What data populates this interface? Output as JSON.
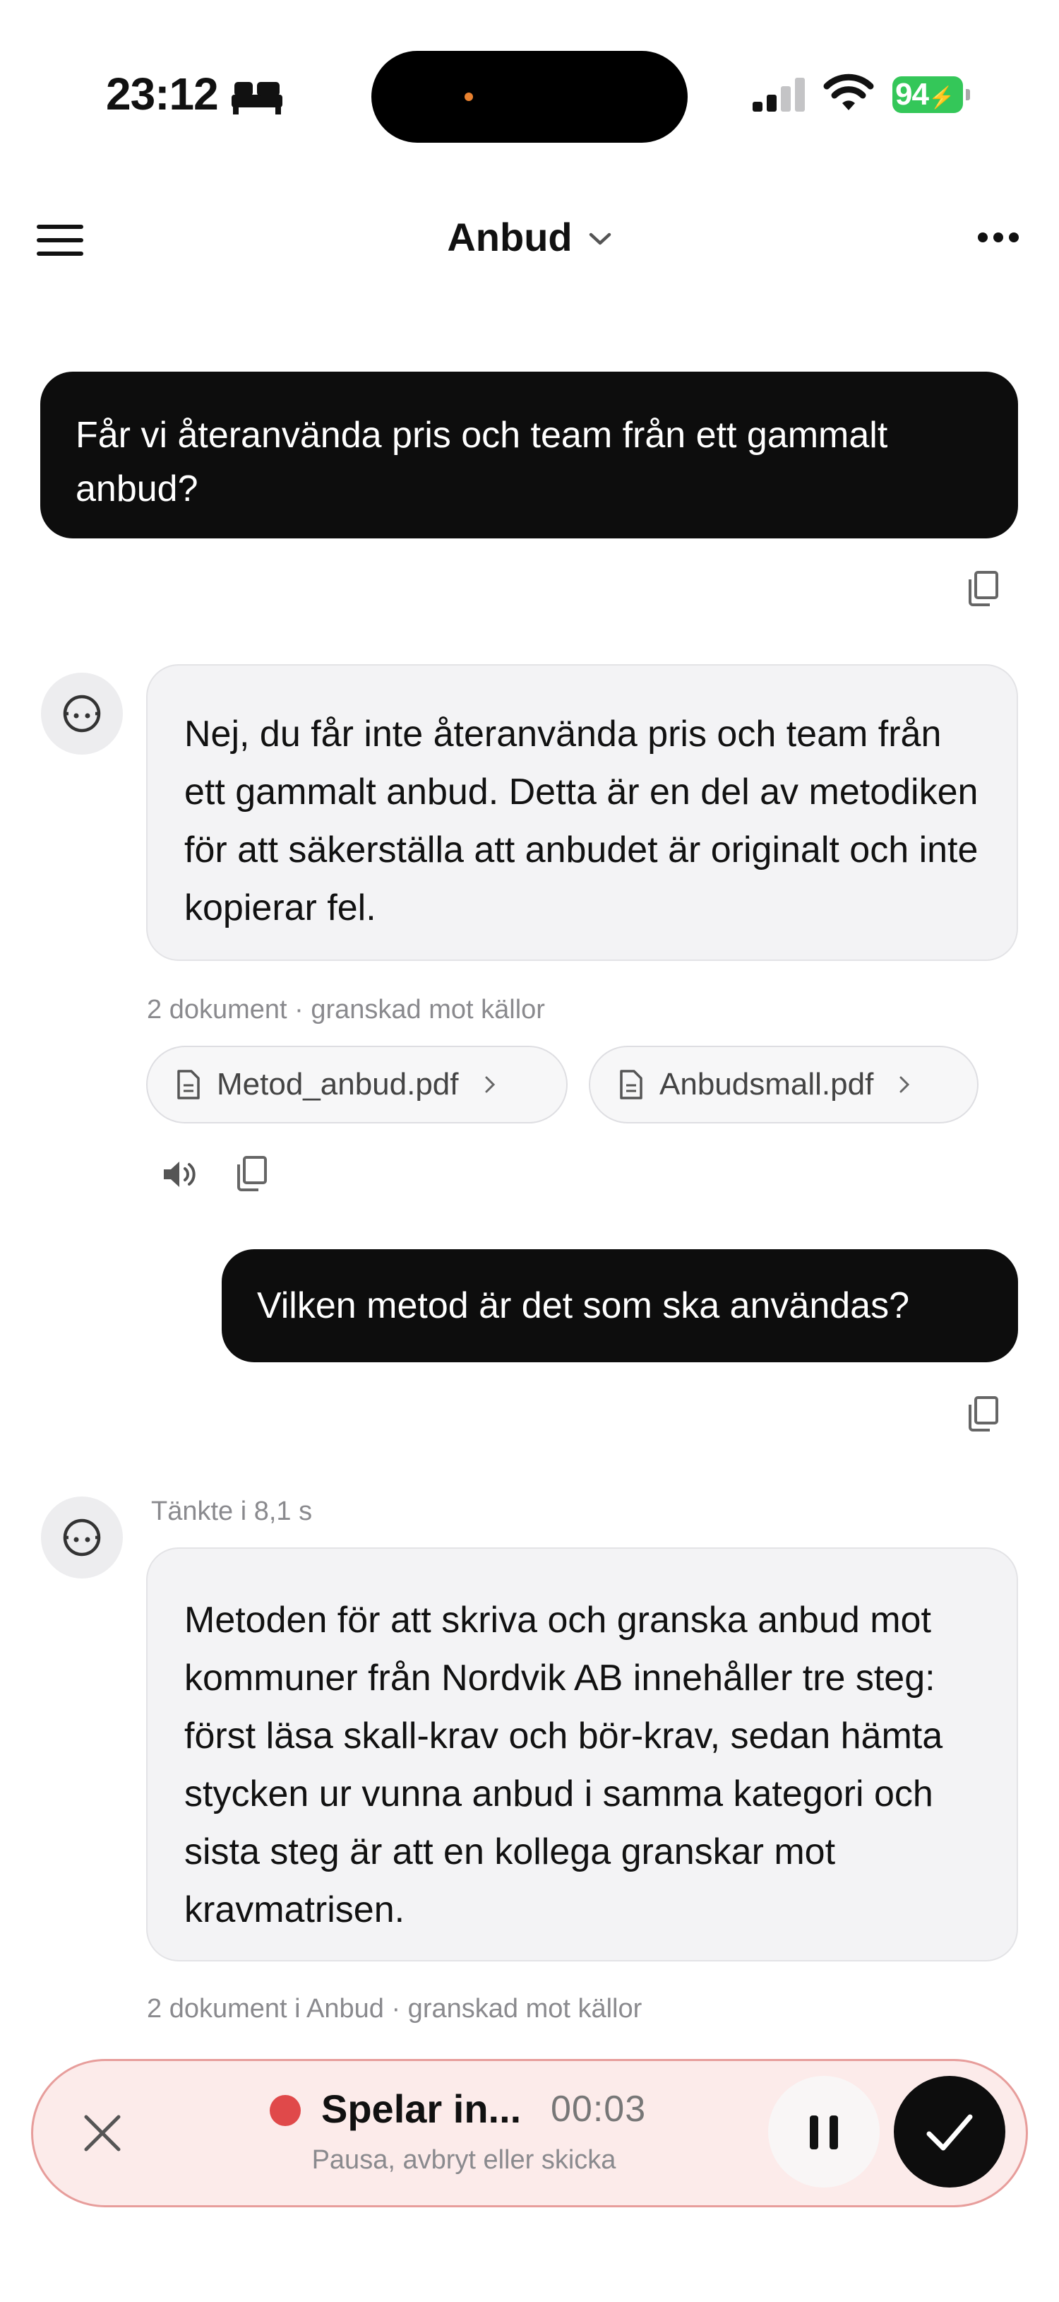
{
  "status_bar": {
    "time": "23:12",
    "battery": "94"
  },
  "header": {
    "title": "Anbud"
  },
  "conversation": {
    "user_message_1": "Får vi återanvända pris och team från ett gammalt anbud?",
    "assistant_message_1": "Nej, du får inte återanvända pris och team från ett gammalt anbud. Detta är en del av metodiken för att säkerställa att anbudet är originalt och inte kopierar fel.",
    "sources_1_meta": "2 dokument · granskad mot källor",
    "sources_1": [
      "Metod_anbud.pdf",
      "Anbudsmall.pdf"
    ],
    "user_message_2": "Vilken metod är det som ska användas?",
    "thinking_label": "Tänkte i 8,1 s",
    "assistant_message_2": "Metoden för att skriva och granska anbud mot kommuner från Nordvik AB innehåller tre steg: först läsa skall-krav och bör-krav, sedan hämta stycken ur vunna anbud i samma kategori och sista steg är att en kollega granskar mot kravmatrisen.",
    "sources_2_meta": "2 dokument i Anbud · granskad mot källor"
  },
  "recording": {
    "status": "Spelar in...",
    "timer": "00:03",
    "hint": "Pausa, avbryt eller skicka"
  },
  "colors": {
    "user_bubble": "#0d0d0d",
    "assistant_bubble": "#f3f3f5",
    "recording_bg": "#fcebea",
    "recording_border": "#e79d9b",
    "recording_dot": "#e0494a",
    "battery": "#34c759"
  },
  "icons": [
    "sleep-icon",
    "signal-icon",
    "wifi-icon",
    "menu-icon",
    "chevron-down-icon",
    "more-icon",
    "copy-icon",
    "bot-avatar-icon",
    "document-icon",
    "speaker-icon",
    "close-icon",
    "pause-icon",
    "checkmark-icon"
  ]
}
